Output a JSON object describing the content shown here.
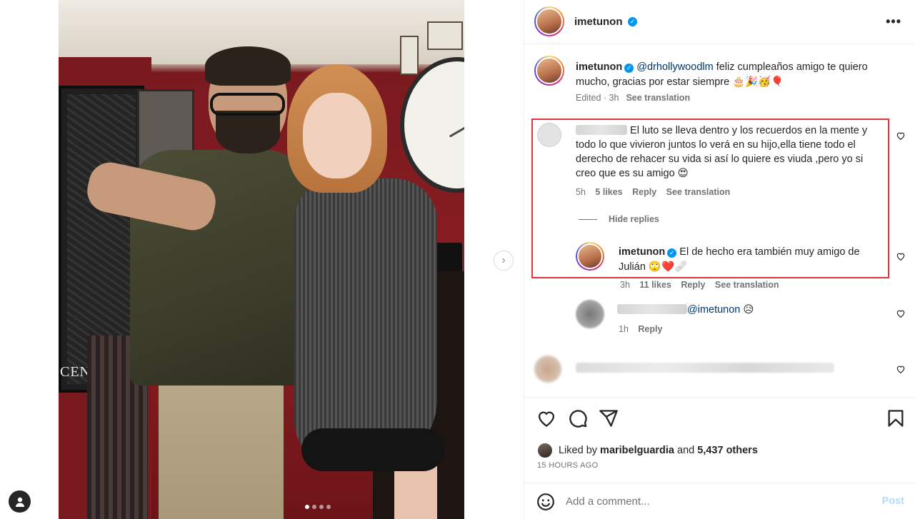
{
  "carousel": {
    "next_icon": "chevron-right-icon",
    "slide_count": 4,
    "active_slide": 1
  },
  "map_text": "CENTRAL",
  "header": {
    "username": "imetunon",
    "verified_glyph": "✓",
    "more_icon": "more-horizontal-icon"
  },
  "caption": {
    "username": "imetunon",
    "mention": "@drhollywoodlm",
    "text": "feliz cumpleaños amigo te quiero mucho, gracias por estar siempre",
    "emojis": "🎂🎉🥳🎈",
    "edited": "Edited · 3h",
    "see_translation": "See translation"
  },
  "comment1": {
    "text": "El luto se lleva dentro y los recuerdos en la mente y todo lo que vivieron juntos lo verá en su hijo,ella tiene todo el derecho de rehacer su vida si así lo quiere es viuda ,pero yo si creo que es su amigo",
    "emoji": "😍",
    "time": "5h",
    "likes": "5 likes",
    "reply": "Reply",
    "see_translation": "See translation"
  },
  "hide_replies": "Hide replies",
  "reply1": {
    "username": "imetunon",
    "text": "El de hecho era también muy amigo de Julián",
    "emojis": "🙄❤️🩹",
    "time": "3h",
    "likes": "11 likes",
    "reply": "Reply",
    "see_translation": "See translation"
  },
  "reply2": {
    "mention": "@imetunon",
    "emoji": "😥",
    "time": "1h",
    "reply": "Reply"
  },
  "likes": {
    "prefix": "Liked by",
    "user": "maribelguardia",
    "and": "and",
    "others": "5,437 others"
  },
  "time_ago": "15 HOURS AGO",
  "add_comment": {
    "placeholder": "Add a comment...",
    "post": "Post"
  },
  "colors": {
    "accent": "#0095f6",
    "highlight": "#e0353b",
    "mention": "#00376b",
    "post_disabled": "#b3dbff"
  }
}
